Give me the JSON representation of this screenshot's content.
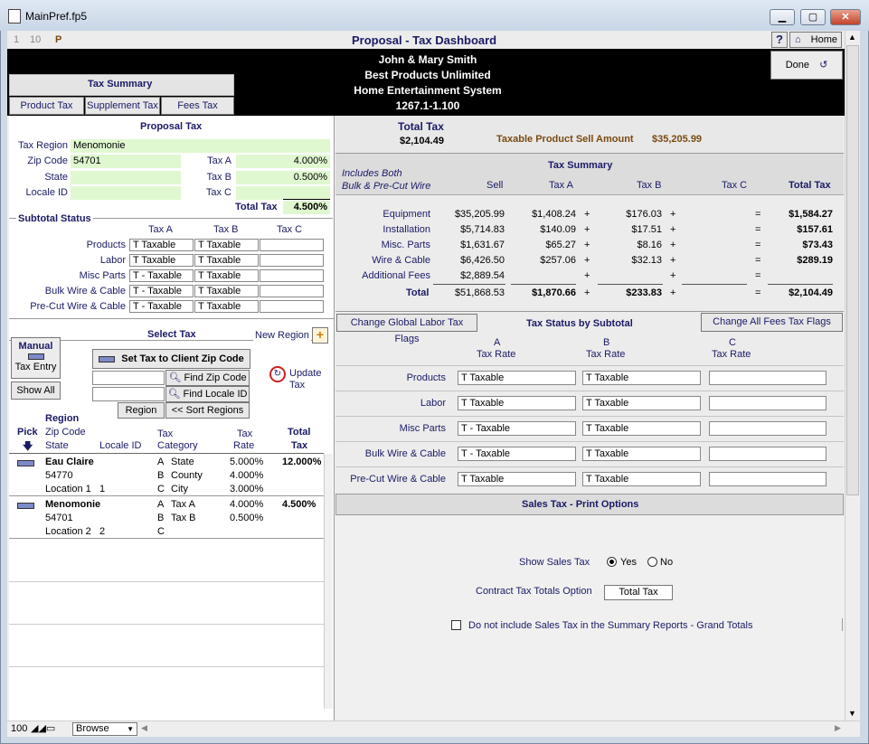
{
  "window": {
    "title": "MainPref.fp5",
    "minimize": "▁",
    "maximize": "▢",
    "close": "✕"
  },
  "toolbar": {
    "n1": "1",
    "n2": "10",
    "p": "P",
    "help": "?",
    "home": "Home",
    "done": "Done"
  },
  "header": {
    "title": "Proposal - Tax Dashboard",
    "client": "John & Mary Smith",
    "company": "Best Products Unlimited",
    "project": "Home Entertainment System",
    "number": "1267.1-1.100"
  },
  "tabs": {
    "title": "Tax Summary",
    "product": "Product Tax",
    "supplement": "Supplement Tax",
    "fees": "Fees Tax"
  },
  "proposal_tax": {
    "title": "Proposal Tax",
    "region_label": "Tax Region",
    "region": "Menomonie",
    "zip_label": "Zip Code",
    "zip": "54701",
    "state_label": "State",
    "state": "",
    "locale_label": "Locale ID",
    "locale": "",
    "taxa_label": "Tax A",
    "taxa": "4.000%",
    "taxb_label": "Tax B",
    "taxb": "0.500%",
    "taxc_label": "Tax C",
    "taxc": "",
    "total_label": "Total Tax",
    "total": "4.500%"
  },
  "subtotal_status": {
    "title": "Subtotal Status",
    "col_a": "Tax A",
    "col_b": "Tax B",
    "col_c": "Tax C",
    "rows": [
      {
        "label": "Products",
        "a": "T  Taxable",
        "b": "T  Taxable",
        "c": ""
      },
      {
        "label": "Labor",
        "a": "T  Taxable",
        "b": "T  Taxable",
        "c": ""
      },
      {
        "label": "Misc Parts",
        "a": "T - Taxable",
        "b": "T  Taxable",
        "c": ""
      },
      {
        "label": "Bulk Wire & Cable",
        "a": "T - Taxable",
        "b": "T  Taxable",
        "c": ""
      },
      {
        "label": "Pre-Cut Wire & Cable",
        "a": "T - Taxable",
        "b": "T  Taxable",
        "c": ""
      }
    ]
  },
  "select_tax": {
    "title": "Select Tax",
    "new_region": "New Region",
    "manual": "Manual",
    "tax_entry": "Tax Entry",
    "show_all": "Show All",
    "set_tax": "Set Tax to Client Zip Code",
    "find_zip": "Find Zip Code",
    "find_locale": "Find Locale ID",
    "region_btn": "Region",
    "sort_regions": "<< Sort Regions",
    "update": "Update",
    "update2": "Tax"
  },
  "list_header": {
    "pick": "Pick",
    "region": "Region",
    "zip": "Zip Code",
    "state": "State",
    "locale": "Locale ID",
    "tax": "Tax",
    "category": "Category",
    "tax2": "Tax",
    "rate": "Rate",
    "total": "Total",
    "total2": "Tax"
  },
  "regions": [
    {
      "name": "Eau Claire",
      "zip": "54770",
      "location": "Location 1",
      "locale": "1",
      "total": "12.000%",
      "cats": [
        {
          "l": "A",
          "c": "State",
          "r": "5.000%"
        },
        {
          "l": "B",
          "c": "County",
          "r": "4.000%"
        },
        {
          "l": "C",
          "c": "City",
          "r": "3.000%"
        }
      ]
    },
    {
      "name": "Menomonie",
      "zip": "54701",
      "location": "Location 2",
      "locale": "2",
      "total": "4.500%",
      "cats": [
        {
          "l": "A",
          "c": "Tax A",
          "r": "4.000%"
        },
        {
          "l": "B",
          "c": "Tax B",
          "r": "0.500%"
        },
        {
          "l": "C",
          "c": "",
          "r": ""
        }
      ]
    }
  ],
  "total_tax": {
    "label": "Total Tax",
    "value": "$2,104.49",
    "sell_label": "Taxable Product Sell Amount",
    "sell": "$35,205.99"
  },
  "summary": {
    "title": "Tax Summary",
    "includes1": "Includes Both",
    "includes2": "Bulk & Pre-Cut Wire",
    "sell": "Sell",
    "taxa": "Tax A",
    "taxb": "Tax B",
    "taxc": "Tax C",
    "total": "Total Tax",
    "rows": [
      {
        "label": "Equipment",
        "sell": "$35,205.99",
        "a": "$1,408.24",
        "b": "$176.03",
        "t": "$1,584.27"
      },
      {
        "label": "Installation",
        "sell": "$5,714.83",
        "a": "$140.09",
        "b": "$17.51",
        "t": "$157.61"
      },
      {
        "label": "Misc. Parts",
        "sell": "$1,631.67",
        "a": "$65.27",
        "b": "$8.16",
        "t": "$73.43"
      },
      {
        "label": "Wire & Cable",
        "sell": "$6,426.50",
        "a": "$257.06",
        "b": "$32.13",
        "t": "$289.19"
      },
      {
        "label": "Additional Fees",
        "sell": "$2,889.54",
        "a": "",
        "b": "",
        "t": ""
      }
    ],
    "total_label": "Total",
    "total_sell": "$51,868.53",
    "total_a": "$1,870.66",
    "total_b": "$233.83",
    "total_t": "$2,104.49",
    "plus": "+",
    "eq": "="
  },
  "status": {
    "labor_btn": "Change Global Labor Tax Flags",
    "title": "Tax Status by Subtotal",
    "fees_btn": "Change All Fees Tax Flags",
    "a": "A",
    "b": "B",
    "c": "C",
    "rate": "Tax Rate",
    "rows": [
      {
        "label": "Products",
        "a": "T  Taxable",
        "b": "T  Taxable",
        "c": ""
      },
      {
        "label": "Labor",
        "a": "T  Taxable",
        "b": "T  Taxable",
        "c": ""
      },
      {
        "label": "Misc Parts",
        "a": "T - Taxable",
        "b": "T  Taxable",
        "c": ""
      },
      {
        "label": "Bulk Wire & Cable",
        "a": "T - Taxable",
        "b": "T  Taxable",
        "c": ""
      },
      {
        "label": "Pre-Cut Wire & Cable",
        "a": "T  Taxable",
        "b": "T  Taxable",
        "c": ""
      }
    ]
  },
  "print": {
    "title": "Sales Tax - Print Options",
    "show_label": "Show Sales Tax",
    "yes": "Yes",
    "no": "No",
    "contract_label": "Contract Tax Totals Option",
    "contract": "Total Tax",
    "exclude": "Do not include Sales Tax in the Summary Reports - Grand Totals"
  },
  "statusbar": {
    "zoom": "100",
    "mode": "Browse"
  }
}
